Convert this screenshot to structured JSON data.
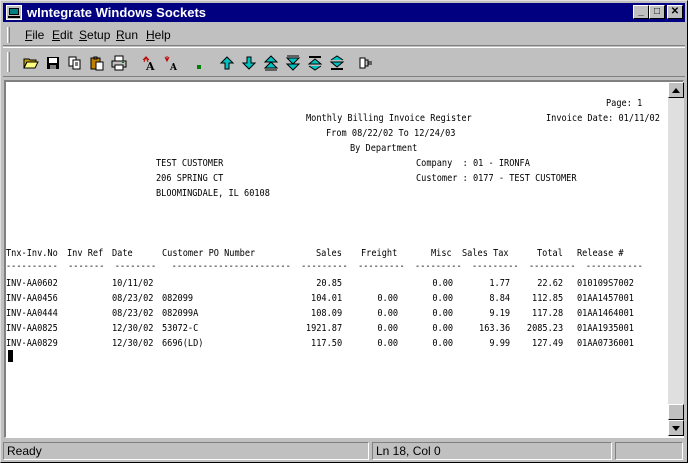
{
  "window": {
    "title": "wIntegrate Windows Sockets",
    "minimize": "_",
    "maximize": "□",
    "close": "✕"
  },
  "menu": [
    {
      "label": "File",
      "key": "F",
      "rest": "ile"
    },
    {
      "label": "Edit",
      "key": "E",
      "rest": "dit"
    },
    {
      "label": "Setup",
      "key": "S",
      "rest": "etup"
    },
    {
      "label": "Run",
      "key": "R",
      "rest": "un"
    },
    {
      "label": "Help",
      "key": "H",
      "rest": "elp"
    }
  ],
  "toolbar": [
    "open-icon",
    "save-icon",
    "copy-icon",
    "paste-icon",
    "print-icon",
    "font-larger-icon",
    "font-smaller-icon",
    "dot-icon",
    "arrow-up-icon",
    "arrow-down-icon",
    "page-up-icon",
    "page-down-icon",
    "top-icon",
    "bottom-icon",
    "connect-icon"
  ],
  "report": {
    "page": "Page: 1",
    "title": "Monthly Billing Invoice Register",
    "invoice_date": "Invoice Date: 01/11/02",
    "range": "From 08/22/02 To 12/24/03",
    "by": "By Department",
    "customer_name": "TEST CUSTOMER",
    "company": "Company  : 01 - IRONFA",
    "address1": "206 SPRING CT",
    "customer": "Customer : 0177 - TEST CUSTOMER",
    "address2": "BLOOMINGDALE, IL 60108",
    "columns": [
      "Tnx-Inv.No",
      "Inv Ref",
      "Date",
      "Customer PO Number",
      "Sales",
      "Freight",
      "Misc",
      "Sales Tax",
      "Total",
      "Release #"
    ],
    "rows": [
      [
        "INV-AA0602",
        "",
        "10/11/02",
        "",
        "20.85",
        "",
        "0.00",
        "1.77",
        "22.62",
        "010109S7002"
      ],
      [
        "INV-AA0456",
        "",
        "08/23/02",
        "082099",
        "104.01",
        "0.00",
        "0.00",
        "8.84",
        "112.85",
        "01AA1457001"
      ],
      [
        "INV-AA0444",
        "",
        "08/23/02",
        "082099A",
        "108.09",
        "0.00",
        "0.00",
        "9.19",
        "117.28",
        "01AA1464001"
      ],
      [
        "INV-AA0825",
        "",
        "12/30/02",
        "53072-C",
        "1921.87",
        "0.00",
        "0.00",
        "163.36",
        "2085.23",
        "01AA1935001"
      ],
      [
        "INV-AA0829",
        "",
        "12/30/02",
        "6696(LD)",
        "117.50",
        "0.00",
        "0.00",
        "9.99",
        "127.49",
        "01AA0736001"
      ]
    ]
  },
  "status": {
    "ready": "Ready",
    "position": "Ln 18, Col 0",
    "extra": ""
  },
  "colors": {
    "title_bg": "#000080",
    "face": "#c0c0c0",
    "teal": "#008080"
  }
}
